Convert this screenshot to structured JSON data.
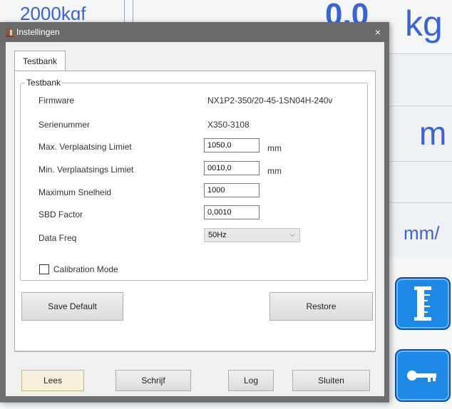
{
  "background": {
    "top_left_text": "2000kgf",
    "top_value_text": "0,0",
    "top_unit_text": "kg",
    "mid_unit_text": "m",
    "lower_unit_text": "mm/",
    "accent_color": "#3a64d6",
    "button_color": "#1e88e5",
    "buttons": [
      {
        "icon": "ruler-icon"
      },
      {
        "icon": "key-icon"
      }
    ]
  },
  "dialog": {
    "title": "Instellingen",
    "close_symbol": "×",
    "tabs": [
      {
        "label": "Testbank"
      }
    ],
    "group": {
      "legend": "Testbank",
      "rows": [
        {
          "label": "Firmware",
          "value": "NX1P2-350/20-45-1SN04H-240v"
        },
        {
          "label": "Serienummer",
          "value": "X350-3108"
        },
        {
          "label": "Max. Verplaatsing Limiet",
          "value": "1050,0",
          "unit": "mm"
        },
        {
          "label": "Min. Verplaatsings Limiet",
          "value": "0010,0",
          "unit": "mm"
        },
        {
          "label": "Maximum Snelheid",
          "value": "1000"
        },
        {
          "label": "SBD Factor",
          "value": "0,0010"
        },
        {
          "label": "Data Freq",
          "value": "50Hz"
        }
      ],
      "calibration_label": "Calibration Mode",
      "calibration_checked": false
    },
    "save_default_label": "Save Default",
    "restore_label": "Restore",
    "footer": {
      "lees": "Lees",
      "schrijf": "Schrijf",
      "log": "Log",
      "sluiten": "Sluiten"
    }
  }
}
